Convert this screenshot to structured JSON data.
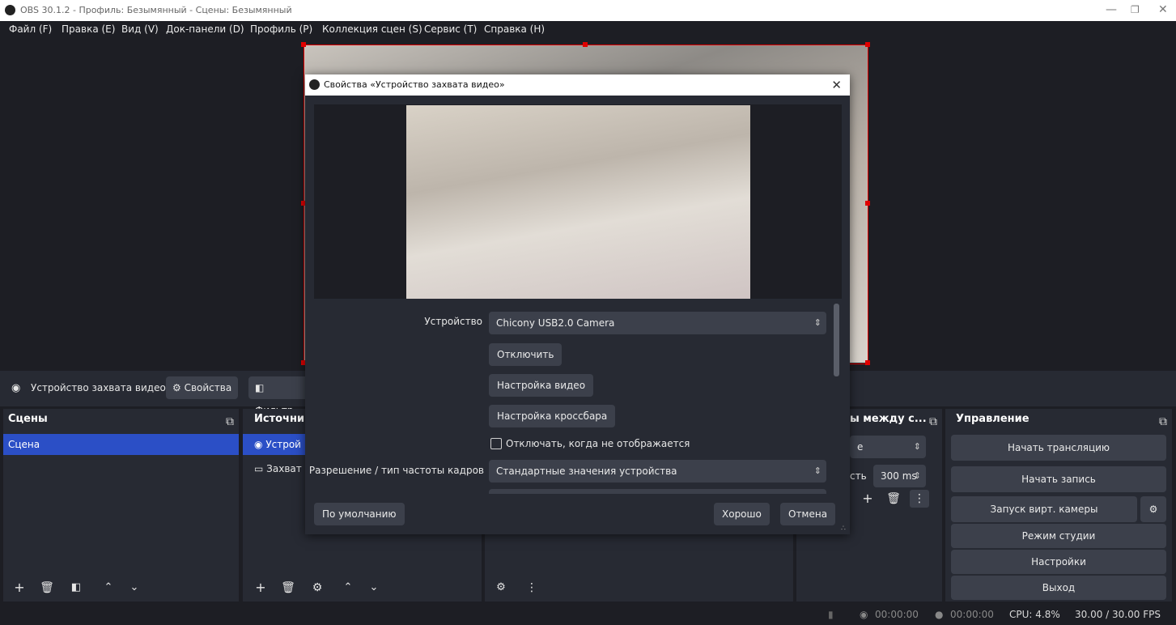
{
  "window": {
    "title": "OBS 30.1.2 - Профиль: Безымянный - Сцены: Безымянный",
    "controls": {
      "minimize": "—",
      "restore": "❐",
      "close": "✕"
    }
  },
  "menu": [
    "Файл (F)",
    "Правка (E)",
    "Вид (V)",
    "Док-панели (D)",
    "Профиль (P)",
    "Коллекция сцен (S)",
    "Сервис (T)",
    "Справка (H)"
  ],
  "source_toolbar": {
    "selected_source": "Устройство захвата видео",
    "properties": "Свойства",
    "filters": "Фильтр"
  },
  "scenes": {
    "title": "Сцены",
    "items": [
      "Сцена"
    ]
  },
  "sources": {
    "title": "Источник",
    "items": [
      "Устрой",
      "Захват"
    ]
  },
  "transitions": {
    "title": "ы между с...",
    "fade_value": "е",
    "duration_label": "сть",
    "duration": "300 ms"
  },
  "controls": {
    "title": "Управление",
    "start_stream": "Начать трансляцию",
    "start_record": "Начать запись",
    "virtual_cam": "Запуск вирт. камеры",
    "studio_mode": "Режим студии",
    "settings": "Настройки",
    "exit": "Выход"
  },
  "status": {
    "stream_time": "00:00:00",
    "record_time": "00:00:00",
    "cpu": "CPU: 4.8%",
    "fps": "30.00 / 30.00 FPS"
  },
  "dialog": {
    "title": "Свойства «Устройство захвата видео»",
    "device_label": "Устройство",
    "device_value": "Chicony USB2.0 Camera",
    "disable_btn": "Отключить",
    "video_config_btn": "Настройка видео",
    "crossbar_btn": "Настройка кроссбара",
    "deactivate_checkbox": "Отключать, когда не отображается",
    "deactivate_checked": false,
    "res_label": "Разрешение / тип частоты кадров",
    "res_value": "Стандартные значения устройства",
    "defaults_btn": "По умолчанию",
    "ok_btn": "Хорошо",
    "cancel_btn": "Отмена"
  },
  "colors": {
    "accent": "#2b4fc6",
    "selection_border": "#e00000",
    "panel": "#272a33",
    "background": "#1d1e24"
  }
}
